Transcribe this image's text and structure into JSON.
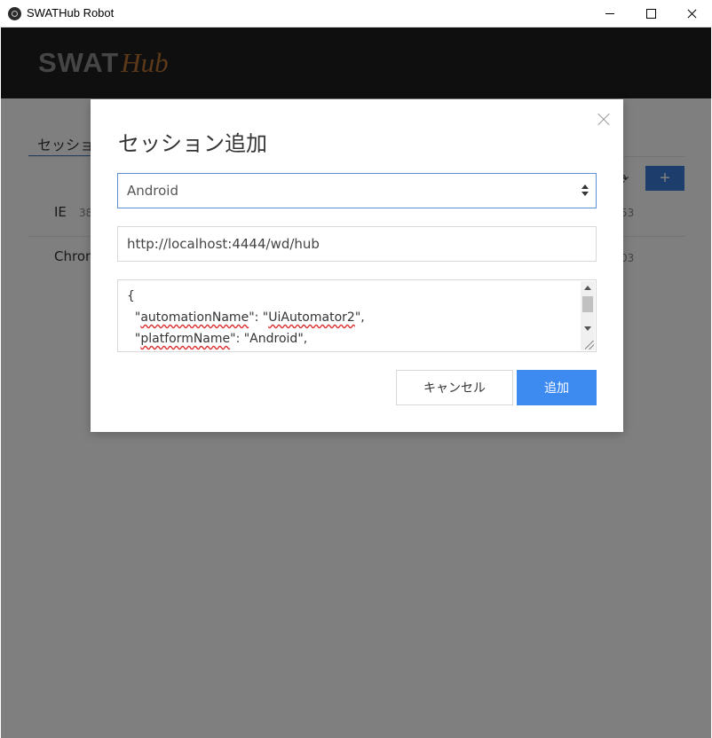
{
  "window": {
    "title": "SWATHub Robot",
    "icon": "swathub-app-icon"
  },
  "header": {
    "logo_left": "SWAT",
    "logo_right": "Hub"
  },
  "page": {
    "tab_label": "セッショ",
    "rows": [
      {
        "name": "IE",
        "meta": "38",
        "tail": "53"
      },
      {
        "name": "Chron",
        "meta": "",
        "tail": "03"
      }
    ],
    "toolbar_icons": [
      "refresh-icon",
      "plus-icon"
    ],
    "add_label": "+",
    "refresh_glyph": "⟳"
  },
  "modal": {
    "title": "セッション追加",
    "platform_value": "Android",
    "url_value": "http://localhost:4444/wd/hub",
    "caps_lines": [
      {
        "prefix": "{",
        "key": "",
        "middle": "",
        "value": "",
        "suffix": ""
      },
      {
        "prefix": "  \"",
        "key": "automationName",
        "middle": "\": \"",
        "value": "UiAutomator2",
        "suffix": "\","
      },
      {
        "prefix": "  \"",
        "key": "platformName",
        "middle": "\": \"Android\",",
        "value": "",
        "suffix": ""
      }
    ],
    "cancel_label": "キャンセル",
    "submit_label": "追加"
  },
  "colors": {
    "accent": "#3d8af0",
    "header_bg": "#1f1f1f",
    "logo_hub": "#b87333"
  }
}
